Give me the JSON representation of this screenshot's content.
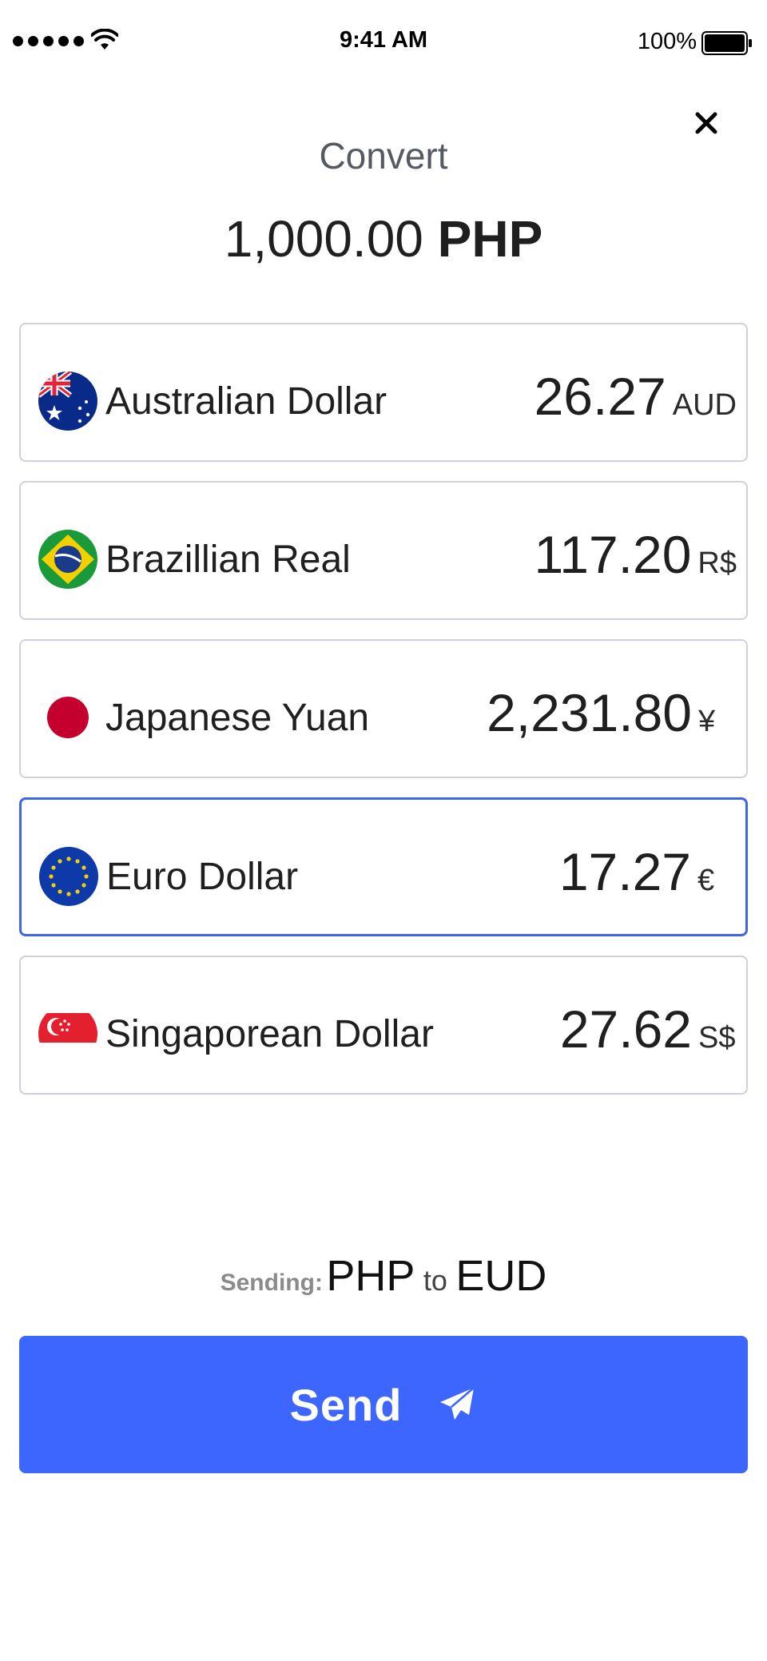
{
  "status_bar": {
    "time": "9:41 AM",
    "battery_percent": "100%",
    "icons": [
      "signal-dots-icon",
      "wifi-icon",
      "battery-icon"
    ]
  },
  "header": {
    "title": "Convert",
    "amount_value": "1,000.00",
    "amount_currency": "PHP",
    "close_icon": "close-icon"
  },
  "currencies": [
    {
      "name": "Australian Dollar",
      "value": "26.27",
      "symbol": "AUD",
      "flag_icon": "australia-flag-icon",
      "selected": false
    },
    {
      "name": "Brazillian Real",
      "value": "117.20",
      "symbol": "R$",
      "flag_icon": "brazil-flag-icon",
      "selected": false
    },
    {
      "name": "Japanese Yuan",
      "value": "2,231.80",
      "symbol": "¥",
      "flag_icon": "japan-flag-icon",
      "selected": false
    },
    {
      "name": "Euro Dollar",
      "value": "17.27",
      "symbol": "€",
      "flag_icon": "eu-flag-icon",
      "selected": true
    },
    {
      "name": "Singaporean Dollar",
      "value": "27.62",
      "symbol": "S$",
      "flag_icon": "singapore-flag-icon",
      "selected": false
    }
  ],
  "sending": {
    "label": "Sending:",
    "from": "PHP",
    "to_word": "to",
    "to": "EUD"
  },
  "send_button": {
    "label": "Send",
    "icon": "paper-plane-icon"
  },
  "colors": {
    "accent": "#3d66ff",
    "selected_border": "#3d66ee",
    "row_border": "#cfd1de",
    "title_gray": "#555a62",
    "label_gray": "#8b8b8b"
  }
}
